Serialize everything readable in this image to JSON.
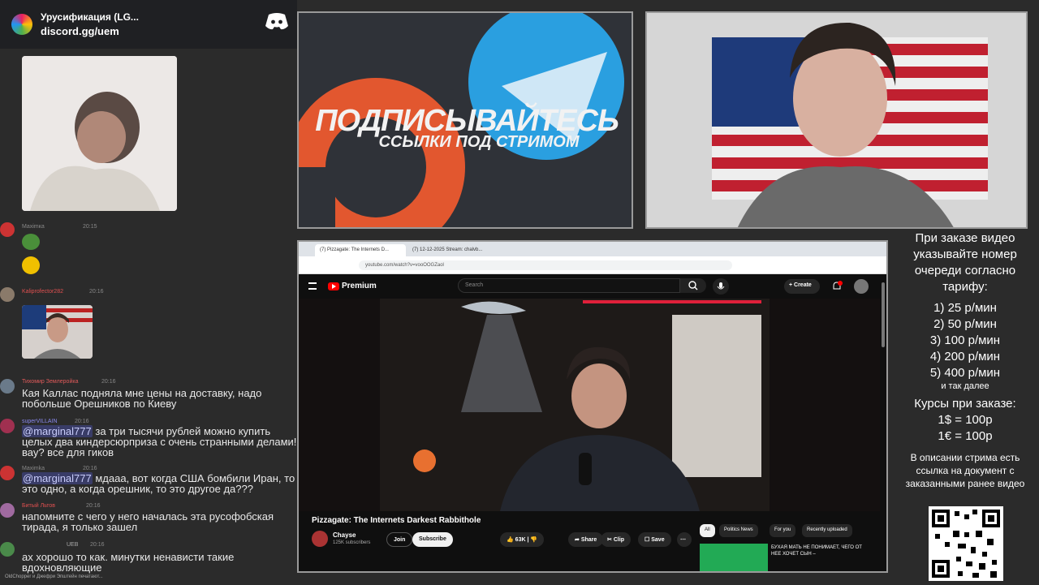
{
  "discord": {
    "server_title": "Урусификация (LG...",
    "invite_link": "discord.gg/uem"
  },
  "chat": {
    "messages": [
      {
        "user": "Maximка",
        "time": "20:15"
      },
      {
        "user": "Kaliprofector282",
        "time": "20:16"
      },
      {
        "user": "Тихомир Землеройка",
        "time": "20:16",
        "text": "Кая Каллас подняла мне цены на доставку, надо побольше Орешников по Киеву"
      },
      {
        "user": "superVILLAIN",
        "time": "20:16",
        "mention": "@marginal777",
        "text": " за три тысячи рублей можно купить целых два киндерсюрприза с очень странными делами! вау? все для гиков"
      },
      {
        "user": "Maximka",
        "time": "20:16",
        "mention": "@marginal777",
        "text": " мдааа, вот когда США бомбили Иран, то это одно, а когда орешник, то это другое да???"
      },
      {
        "user": "Битый Льтов",
        "time": "20:16",
        "text": "напомните с чего у него началась эта русофобская тирада, я только зашел"
      },
      {
        "user": "UEB",
        "time": "20:16",
        "text": "ах хорошо то как. минутки ненависти такие вдохновляющие"
      }
    ],
    "typing": "OldChopper и Джефри Эпштейн печатают..."
  },
  "promo": {
    "title": "ПОДПИСЫВАЙТЕСЬ",
    "subtitle": "ССЫЛКИ ПОД СТРИМОМ"
  },
  "browser": {
    "tab1": "(7) Pizzagate: The Internets D...",
    "tab2": "(7) 12-12-2025 Stream: chalvb...",
    "url": "youtube.com/watch?v=vooOOGZaol"
  },
  "youtube": {
    "logo_text": "Premium",
    "search_placeholder": "Search",
    "create_label": "+ Create",
    "video_title": "Pizzagate: The Internets Darkest Rabbithole",
    "channel_name": "Chayse",
    "channel_subs": "125K subscribers",
    "join_label": "Join",
    "subscribe_label": "Subscribe",
    "like_label": "63K",
    "share_label": "Share",
    "clip_label": "Clip",
    "save_label": "Save",
    "more_label": "⋯",
    "chips": [
      "All",
      "Politics News",
      "For you",
      "Recently uploaded"
    ],
    "next_video_text": "БУХАЯ МАТЬ НЕ ПОНИМАЕТ, ЧЕГО ОТ НЕЕ ХОЧЕТ СЫН –"
  },
  "info": {
    "intro": "При заказе видео указывайте номер очереди согласно тарифу:",
    "prices": [
      "1) 25 р/мин",
      "2) 50 р/мин",
      "3) 100 р/мин",
      "4) 200 р/мин",
      "5) 400 р/мин"
    ],
    "etc": "и так далее",
    "rates_title": "Курсы при заказе:",
    "rates": [
      "1$ = 100р",
      "1€ = 100р"
    ],
    "description": "В описании стрима есть ссылка на документ с заказанными ранее видео"
  },
  "colors": {
    "yt_red": "#ff0000",
    "discord_blurple": "#5865f2",
    "promo_orange": "#e2572f",
    "promo_blue": "#2a9fe0"
  }
}
